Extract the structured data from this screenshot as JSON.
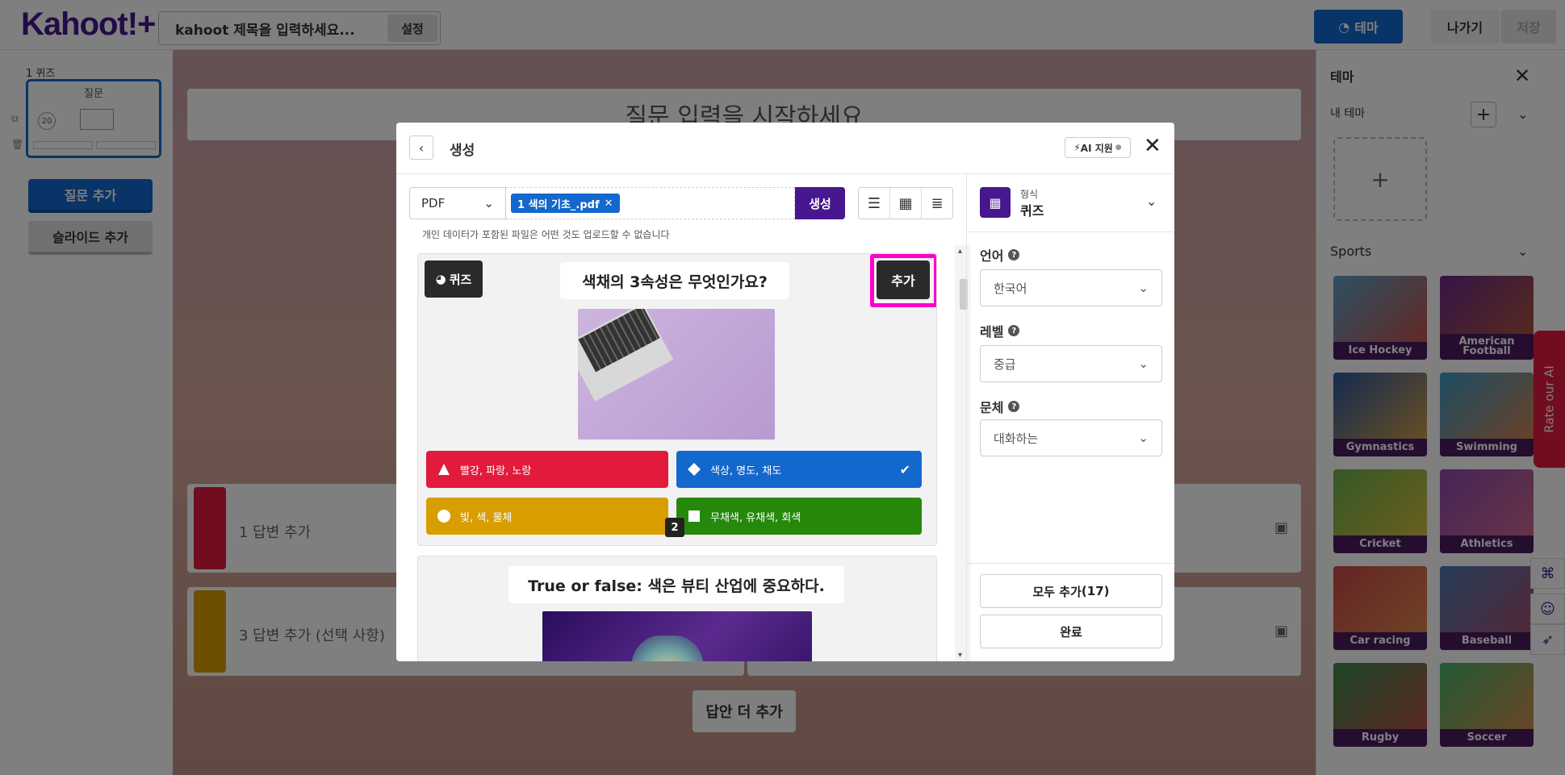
{
  "app": {
    "logo": "Kahoot!+"
  },
  "header": {
    "title_placeholder": "kahoot 제목을 입력하세요...",
    "settings_label": "설정",
    "theme_label": "테마",
    "exit_label": "나가기",
    "save_label": "저장"
  },
  "left_sidebar": {
    "slide_number": "1 퀴즈",
    "thumb_title": "질문",
    "thumb_timer": "20",
    "add_question": "질문 추가",
    "add_slide": "슬라이드 추가"
  },
  "editor": {
    "question_placeholder": "질문 입력을 시작하세요",
    "answer1_placeholder": "1 답변 추가",
    "answer3_placeholder": "3 답변 추가 (선택 사항)",
    "add_more_answers": "답안 더 추가"
  },
  "theme_panel": {
    "title": "테마",
    "my_themes": "내 테마",
    "category": "Sports",
    "tiles": [
      {
        "label": "Ice Hockey"
      },
      {
        "label": "American Football"
      },
      {
        "label": "Gymnastics"
      },
      {
        "label": "Swimming"
      },
      {
        "label": "Cricket"
      },
      {
        "label": "Athletics"
      },
      {
        "label": "Car racing"
      },
      {
        "label": "Baseball"
      },
      {
        "label": "Rugby"
      },
      {
        "label": "Soccer"
      }
    ]
  },
  "rate_tab": "Rate our AI",
  "modal": {
    "title": "생성",
    "ai_badge": "AI 지원",
    "source_type": "PDF",
    "file_name": "1 색의 기초_.pdf",
    "generate_label": "생성",
    "privacy_note": "개인 데이터가 포함된 파일은 어떤 것도 업로드할 수 없습니다",
    "cards": [
      {
        "type_label": "퀴즈",
        "question": "색채의 3속성은 무엇인가요?",
        "add_label": "추가",
        "page": "2",
        "answers": [
          {
            "text": "빨강, 파랑, 노랑",
            "color": "#e21b3c",
            "shape": "triangle",
            "correct": false
          },
          {
            "text": "색상, 명도, 채도",
            "color": "#1368ce",
            "shape": "diamond",
            "correct": true
          },
          {
            "text": "빛, 색, 물체",
            "color": "#d89e00",
            "shape": "circle",
            "correct": false
          },
          {
            "text": "무채색, 유채색, 회색",
            "color": "#26890c",
            "shape": "square",
            "correct": false
          }
        ]
      },
      {
        "question": "True or false: 색은 뷰티 산업에 중요하다."
      }
    ],
    "settings": {
      "format_label": "형식",
      "format_value": "퀴즈",
      "language_label": "언어",
      "language_value": "한국어",
      "level_label": "레벨",
      "level_value": "중급",
      "style_label": "문체",
      "style_value": "대화하는"
    },
    "add_all_label": "모두 추가",
    "add_all_count": "(17)",
    "done_label": "완료"
  }
}
